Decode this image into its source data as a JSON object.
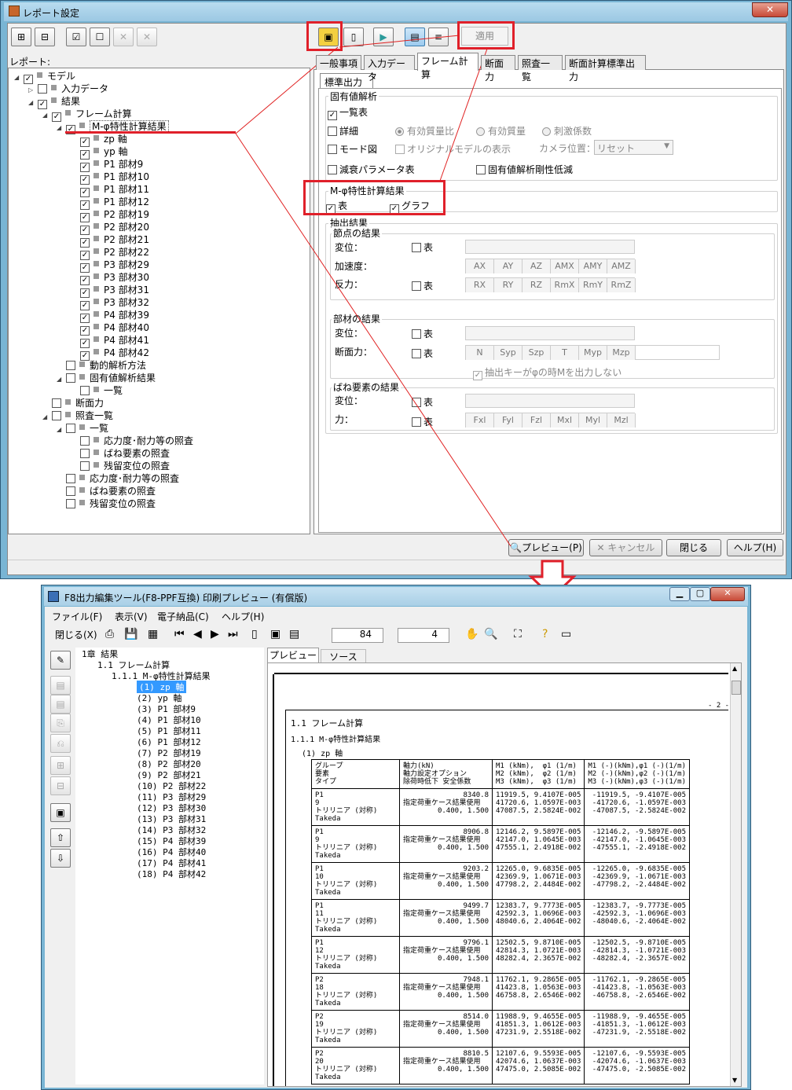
{
  "window1": {
    "title": "レポート設定",
    "close": "✕"
  },
  "toolbar": {
    "apply_label": "適用"
  },
  "report_label": "レポート:",
  "tree": [
    {
      "d": 0,
      "exp": "◢",
      "cb": "✓",
      "label": "モデル"
    },
    {
      "d": 1,
      "exp": "▷",
      "cb": "",
      "label": "入力データ"
    },
    {
      "d": 1,
      "exp": "◢",
      "cb": "✓",
      "label": "結果"
    },
    {
      "d": 2,
      "exp": "◢",
      "cb": "✓",
      "label": "フレーム計算"
    },
    {
      "d": 3,
      "exp": "◢",
      "cb": "✓",
      "label": "M-φ特性計算結果"
    },
    {
      "d": 4,
      "exp": "",
      "cb": "✓",
      "label": "zp 軸"
    },
    {
      "d": 4,
      "exp": "",
      "cb": "✓",
      "label": "yp 軸"
    },
    {
      "d": 4,
      "exp": "",
      "cb": "✓",
      "label": "P1 部材9"
    },
    {
      "d": 4,
      "exp": "",
      "cb": "✓",
      "label": "P1 部材10"
    },
    {
      "d": 4,
      "exp": "",
      "cb": "✓",
      "label": "P1 部材11"
    },
    {
      "d": 4,
      "exp": "",
      "cb": "✓",
      "label": "P1 部材12"
    },
    {
      "d": 4,
      "exp": "",
      "cb": "✓",
      "label": "P2 部材19"
    },
    {
      "d": 4,
      "exp": "",
      "cb": "✓",
      "label": "P2 部材20"
    },
    {
      "d": 4,
      "exp": "",
      "cb": "✓",
      "label": "P2 部材21"
    },
    {
      "d": 4,
      "exp": "",
      "cb": "✓",
      "label": "P2 部材22"
    },
    {
      "d": 4,
      "exp": "",
      "cb": "✓",
      "label": "P3 部材29"
    },
    {
      "d": 4,
      "exp": "",
      "cb": "✓",
      "label": "P3 部材30"
    },
    {
      "d": 4,
      "exp": "",
      "cb": "✓",
      "label": "P3 部材31"
    },
    {
      "d": 4,
      "exp": "",
      "cb": "✓",
      "label": "P3 部材32"
    },
    {
      "d": 4,
      "exp": "",
      "cb": "✓",
      "label": "P4 部材39"
    },
    {
      "d": 4,
      "exp": "",
      "cb": "✓",
      "label": "P4 部材40"
    },
    {
      "d": 4,
      "exp": "",
      "cb": "✓",
      "label": "P4 部材41"
    },
    {
      "d": 4,
      "exp": "",
      "cb": "✓",
      "label": "P4 部材42"
    },
    {
      "d": 3,
      "exp": "",
      "cb": "",
      "label": "動的解析方法"
    },
    {
      "d": 3,
      "exp": "◢",
      "cb": "",
      "label": "固有値解析結果"
    },
    {
      "d": 4,
      "exp": "",
      "cb": "",
      "label": "一覧"
    },
    {
      "d": 2,
      "exp": "",
      "cb": "",
      "label": "断面力"
    },
    {
      "d": 2,
      "exp": "◢",
      "cb": "",
      "label": "照査一覧"
    },
    {
      "d": 3,
      "exp": "◢",
      "cb": "",
      "label": "一覧"
    },
    {
      "d": 4,
      "exp": "",
      "cb": "",
      "label": "応力度･耐力等の照査"
    },
    {
      "d": 4,
      "exp": "",
      "cb": "",
      "label": "ばね要素の照査"
    },
    {
      "d": 4,
      "exp": "",
      "cb": "",
      "label": "残留変位の照査"
    },
    {
      "d": 3,
      "exp": "",
      "cb": "",
      "label": "応力度･耐力等の照査"
    },
    {
      "d": 3,
      "exp": "",
      "cb": "",
      "label": "ばね要素の照査"
    },
    {
      "d": 3,
      "exp": "",
      "cb": "",
      "label": "残留変位の照査"
    }
  ],
  "tabs": [
    "一般事項",
    "入力データ",
    "フレーム計算",
    "断面力",
    "照査一覧",
    "断面計算標準出力"
  ],
  "subtab": "標準出力",
  "eig": {
    "title": "固有値解析",
    "list": "一覧表",
    "detail": "詳細",
    "r1": "有効質量比",
    "r2": "有効質量",
    "r3": "刺激係数",
    "mode": "モード図",
    "orig": "オリジナルモデルの表示",
    "cam": "カメラ位置：",
    "cam_val": "リセット",
    "damp": "減衰パラメータ表",
    "stiff": "固有値解析剛性低減"
  },
  "mphi": {
    "title": "M-φ特性計算結果",
    "table": "表",
    "graph": "グラフ"
  },
  "extract": {
    "title": "抽出結果",
    "node": "節点の結果",
    "disp": "変位：",
    "acc": "加速度：",
    "react": "反力：",
    "tbl": "表",
    "acc_btns": [
      "AX",
      "AY",
      "AZ",
      "AMX",
      "AMY",
      "AMZ"
    ],
    "react_btns": [
      "RX",
      "RY",
      "RZ",
      "RmX",
      "RmY",
      "RmZ"
    ],
    "member": "部材の結果",
    "sect": "断面力：",
    "sect_btns": [
      "N",
      "Syp",
      "Szp",
      "T",
      "Myp",
      "Mzp"
    ],
    "note": "抽出キーがφの時Mを出力しない",
    "spring": "ばね要素の結果",
    "force": "力：",
    "force_btns": [
      "Fxl",
      "Fyl",
      "Fzl",
      "Mxl",
      "Myl",
      "Mzl"
    ]
  },
  "bottom": {
    "preview": "プレビュー(P)",
    "cancel": "キャンセル",
    "close": "閉じる",
    "help": "ヘルプ(H)"
  },
  "window2": {
    "title": "F8出力編集ツール(F8-PPF互換) 印刷プレビュー (有償版)"
  },
  "menu": [
    "ファイル(F)",
    "表示(V)",
    "電子納品(C)",
    "ヘルプ(H)"
  ],
  "tb2": {
    "close": "閉じる(X)",
    "zoom": "84",
    "page": "4"
  },
  "ptabs": [
    "プレビュー",
    "ソース"
  ],
  "ptree": {
    "ch": "1章 結果",
    "s1": "1.1 フレーム計算",
    "s2": "1.1.1 M-φ特性計算結果",
    "items": [
      "(1) zp 軸",
      "(2) yp 軸",
      "(3) P1 部材9",
      "(4) P1 部材10",
      "(5) P1 部材11",
      "(6) P1 部材12",
      "(7) P2 部材19",
      "(8) P2 部材20",
      "(9) P2 部材21",
      "(10) P2 部材22",
      "(11) P3 部材29",
      "(12) P3 部材30",
      "(13) P3 部材31",
      "(14) P3 部材32",
      "(15) P4 部材39",
      "(16) P4 部材40",
      "(17) P4 部材41",
      "(18) P4 部材42"
    ]
  },
  "doc": {
    "pagenum": "- 2 -",
    "h1": "1.1 フレーム計算",
    "h2": "1.1.1 M-φ特性計算結果",
    "h3": "(1) zp 軸",
    "head": [
      "グループ\n要素\nタイプ",
      "軸力(kN)\n軸力設定オプション\n除荷時低下 安全係数",
      "M1 (kNm),  φ1 (1/m)\nM2 (kNm),  φ2 (1/m)\nM3 (kNm),  φ3 (1/m)",
      "M1 (-)(kNm),φ1 (-)(1/m)\nM2 (-)(kNm),φ2 (-)(1/m)\nM3 (-)(kNm),φ3 (-)(1/m)"
    ],
    "rows": [
      {
        "g": "P1",
        "e": "9",
        "t": "トリリニア (対称)",
        "a": "Takeda",
        "n": "8340.8",
        "o": "指定荷重ケース結果使用",
        "f": "0.400,      1.500",
        "p": "11919.5, 9.4107E-005\n41720.6, 1.0597E-003\n47087.5, 2.5824E-002",
        "m": "-11919.5, -9.4107E-005\n-41720.6, -1.0597E-003\n-47087.5, -2.5824E-002"
      },
      {
        "g": "P1",
        "e": "9",
        "t": "トリリニア (対称)",
        "a": "Takeda",
        "n": "8906.8",
        "o": "指定荷重ケース結果使用",
        "f": "0.400,      1.500",
        "p": "12146.2, 9.5897E-005\n42147.0, 1.0645E-003\n47555.1, 2.4918E-002",
        "m": "-12146.2, -9.5897E-005\n-42147.0, -1.0645E-003\n-47555.1, -2.4918E-002"
      },
      {
        "g": "P1",
        "e": "10",
        "t": "トリリニア (対称)",
        "a": "Takeda",
        "n": "9203.2",
        "o": "指定荷重ケース結果使用",
        "f": "0.400,      1.500",
        "p": "12265.0, 9.6835E-005\n42369.9, 1.0671E-003\n47798.2, 2.4484E-002",
        "m": "-12265.0, -9.6835E-005\n-42369.9, -1.0671E-003\n-47798.2, -2.4484E-002"
      },
      {
        "g": "P1",
        "e": "11",
        "t": "トリリニア (対称)",
        "a": "Takeda",
        "n": "9499.7",
        "o": "指定荷重ケース結果使用",
        "f": "0.400,      1.500",
        "p": "12383.7, 9.7773E-005\n42592.3, 1.0696E-003\n48040.6, 2.4064E-002",
        "m": "-12383.7, -9.7773E-005\n-42592.3, -1.0696E-003\n-48040.6, -2.4064E-002"
      },
      {
        "g": "P1",
        "e": "12",
        "t": "トリリニア (対称)",
        "a": "Takeda",
        "n": "9796.1",
        "o": "指定荷重ケース結果使用",
        "f": "0.400,      1.500",
        "p": "12502.5, 9.8710E-005\n42814.3, 1.0721E-003\n48282.4, 2.3657E-002",
        "m": "-12502.5, -9.8710E-005\n-42814.3, -1.0721E-003\n-48282.4, -2.3657E-002"
      },
      {
        "g": "P2",
        "e": "18",
        "t": "トリリニア (対称)",
        "a": "Takeda",
        "n": "7948.1",
        "o": "指定荷重ケース結果使用",
        "f": "0.400,      1.500",
        "p": "11762.1, 9.2865E-005\n41423.8, 1.0563E-003\n46758.8, 2.6546E-002",
        "m": "-11762.1, -9.2865E-005\n-41423.8, -1.0563E-003\n-46758.8, -2.6546E-002"
      },
      {
        "g": "P2",
        "e": "19",
        "t": "トリリニア (対称)",
        "a": "Takeda",
        "n": "8514.0",
        "o": "指定荷重ケース結果使用",
        "f": "0.400,      1.500",
        "p": "11988.9, 9.4655E-005\n41851.3, 1.0612E-003\n47231.9, 2.5518E-002",
        "m": "-11988.9, -9.4655E-005\n-41851.3, -1.0612E-003\n-47231.9, -2.5518E-002"
      },
      {
        "g": "P2",
        "e": "20",
        "t": "トリリニア (対称)",
        "a": "Takeda",
        "n": "8810.5",
        "o": "指定荷重ケース結果使用",
        "f": "0.400,      1.500",
        "p": "12107.6, 9.5593E-005\n42074.6, 1.0637E-003\n47475.0, 2.5085E-002",
        "m": "-12107.6, -9.5593E-005\n-42074.6, -1.0637E-003\n-47475.0, -2.5085E-002"
      }
    ]
  },
  "colors": {
    "red": "#e0202a",
    "sel": "#3399ff"
  }
}
